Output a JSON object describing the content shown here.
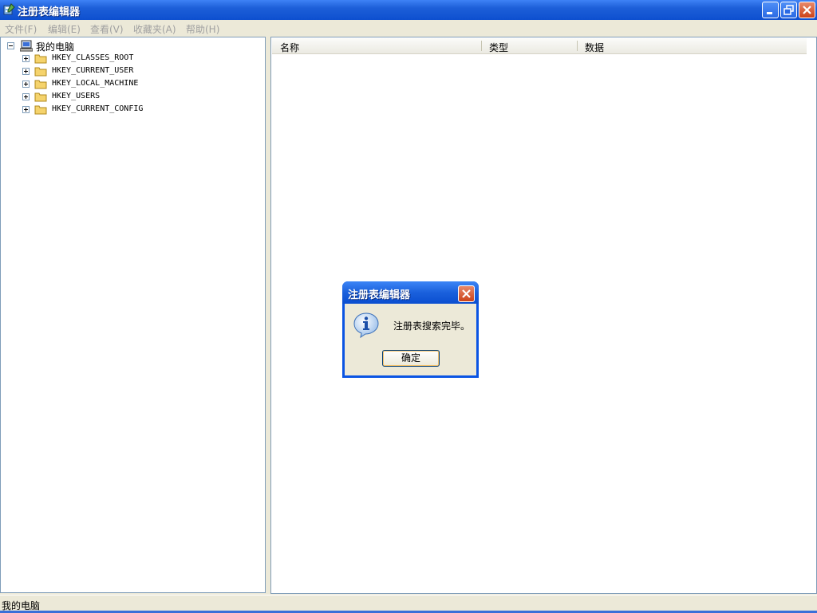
{
  "window": {
    "title": "注册表编辑器"
  },
  "menu": {
    "items": [
      "文件(F)",
      "编辑(E)",
      "查看(V)",
      "收藏夹(A)",
      "帮助(H)"
    ]
  },
  "tree": {
    "root": "我的电脑",
    "children": [
      "HKEY_CLASSES_ROOT",
      "HKEY_CURRENT_USER",
      "HKEY_LOCAL_MACHINE",
      "HKEY_USERS",
      "HKEY_CURRENT_CONFIG"
    ]
  },
  "list": {
    "columns": [
      "名称",
      "类型",
      "数据"
    ]
  },
  "status": {
    "text": "我的电脑"
  },
  "dialog": {
    "title": "注册表编辑器",
    "message": "注册表搜索完毕。",
    "ok_label": "确定",
    "icon": "info-icon"
  },
  "colors": {
    "title_bar": "#0d4fcf",
    "close_button": "#cc4218",
    "window_face": "#ece9d8"
  }
}
